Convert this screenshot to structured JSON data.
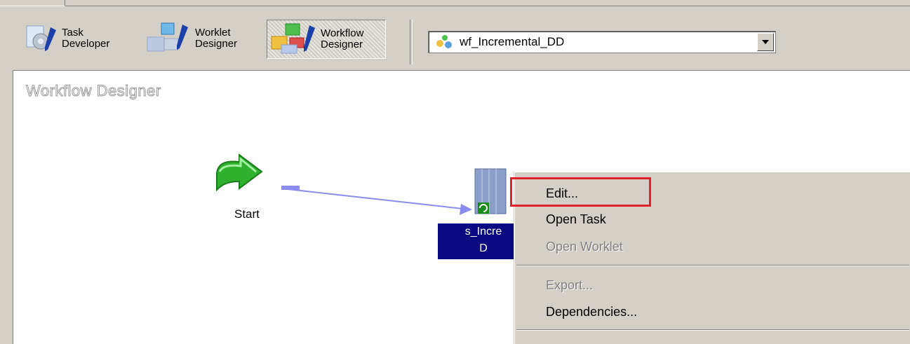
{
  "toolbar": {
    "task_developer": [
      "Task",
      "Developer"
    ],
    "worklet_designer": [
      "Worklet",
      "Designer"
    ],
    "workflow_designer": [
      "Workflow",
      "Designer"
    ],
    "workflow_selector_value": "wf_Incremental_DD"
  },
  "canvas": {
    "title": "Workflow Designer",
    "start_label": "Start",
    "session_label_line1": "s_Incre",
    "session_label_line2": "D"
  },
  "context_menu": {
    "items": [
      {
        "label": "Edit...",
        "enabled": true
      },
      {
        "label": "Open Task",
        "enabled": true
      },
      {
        "label": "Open Worklet",
        "enabled": false
      },
      {
        "label": "Export...",
        "enabled": false
      },
      {
        "label": "Dependencies...",
        "enabled": true
      }
    ]
  },
  "colors": {
    "highlight": "#e2202a",
    "selection": "#0a0a80",
    "link": "#8c8cf0"
  }
}
